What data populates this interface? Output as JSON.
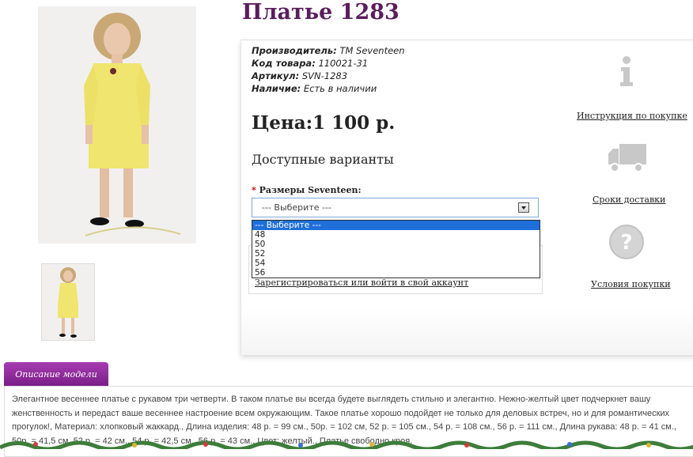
{
  "product": {
    "title": "Платье 1283",
    "manufacturer_label": "Производитель:",
    "manufacturer": "TM Seventeen",
    "code_label": "Код товара:",
    "code": "110021-31",
    "sku_label": "Артикул:",
    "sku": "SVN-1283",
    "availability_label": "Наличие:",
    "availability": "Есть в наличии",
    "price": "Цена:1 100 р."
  },
  "options": {
    "heading": "Доступные варианты",
    "size_required_mark": "*",
    "size_label": "Размеры Seventeen:",
    "selected": "--- Выберите ---",
    "list": [
      "--- Выберите ---",
      "48",
      "50",
      "52",
      "54",
      "56"
    ]
  },
  "cart": {
    "login_link": "Зарегистрироваться или войти в свой аккаунт"
  },
  "sidebar": {
    "instruction": "Инструкция по покупке",
    "delivery": "Сроки доставки",
    "terms": "Условия покупки"
  },
  "description": {
    "tab_label": "Описание модели",
    "text": "Элегантное весеннее платье с рукавом три четверти. В таком платье вы всегда будете выглядеть стильно и элегантно. Нежно-желтый цвет подчеркнет вашу женственность и передаст ваше весеннее настроение всем окружающим. Такое платье хорошо подойдет не только для деловых встреч, но и для романтических прогулок!, Материал: хлопковый жаккард., Длина изделия: 48 р. = 99 см., 50р. = 102 см, 52 р. = 105 см., 54 р. = 108 см., 56 р. = 111 см., Длина рукава: 48 р. = 41 см., 50р. = 41,5 см, 52 р. = 42 см., 54 р. = 42,5 см., 56 р. = 43 см., Цвет: желтый., Платье свободно кроя."
  },
  "colors": {
    "title": "#5a1d5e",
    "tab": "#8e2a9c",
    "dress": "#f0e56e",
    "dropdown_highlight": "#1e6fd9"
  },
  "icons": [
    "info-icon",
    "truck-icon",
    "question-icon",
    "chevron-down-icon"
  ]
}
